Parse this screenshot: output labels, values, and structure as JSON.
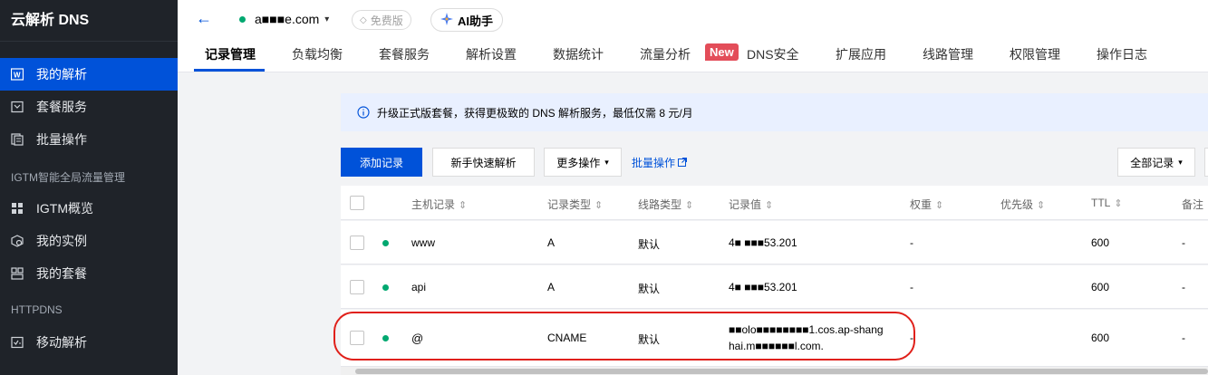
{
  "sidebar": {
    "title": "云解析 DNS",
    "items": [
      {
        "label": "我的解析",
        "icon": "w-icon"
      },
      {
        "label": "套餐服务",
        "icon": "package-icon"
      },
      {
        "label": "批量操作",
        "icon": "batch-icon"
      },
      {
        "label": "IGTM概览",
        "icon": "grid-icon"
      },
      {
        "label": "我的实例",
        "icon": "instance-icon"
      },
      {
        "label": "我的套餐",
        "icon": "list-icon"
      },
      {
        "label": "移动解析",
        "icon": "mobile-icon"
      }
    ],
    "groups": [
      "IGTM智能全局流量管理",
      "HTTPDNS"
    ]
  },
  "header": {
    "back": "←",
    "domain": "a■■■e.com",
    "free_badge": "免费版",
    "ai_label": "AI助手"
  },
  "tabs": [
    "记录管理",
    "负载均衡",
    "套餐服务",
    "解析设置",
    "数据统计",
    "流量分析",
    "DNS安全",
    "扩展应用",
    "线路管理",
    "权限管理",
    "操作日志"
  ],
  "new_badge": "New",
  "notice": "升级正式版套餐，获得更极致的 DNS 解析服务，最低仅需 8 元/月",
  "toolbar": {
    "add": "添加记录",
    "quick": "新手快速解析",
    "more": "更多操作",
    "batch": "批量操作",
    "filter": "全部记录"
  },
  "table": {
    "headers": [
      "主机记录",
      "记录类型",
      "线路类型",
      "记录值",
      "权重",
      "优先级",
      "TTL",
      "备注"
    ],
    "rows": [
      {
        "host": "www",
        "type": "A",
        "line": "默认",
        "value": "4■ ■■■53.201",
        "value2": "",
        "weight": "-",
        "priority": "",
        "ttl": "600",
        "note": "-"
      },
      {
        "host": "api",
        "type": "A",
        "line": "默认",
        "value": "4■ ■■■53.201",
        "value2": "",
        "weight": "-",
        "priority": "",
        "ttl": "600",
        "note": "-"
      },
      {
        "host": "@",
        "type": "CNAME",
        "line": "默认",
        "value": "■■olo■■■■■■■■1.cos.ap-shang",
        "value2": "hai.m■■■■■■l.com.",
        "weight": "-",
        "priority": "",
        "ttl": "600",
        "note": "-"
      }
    ]
  },
  "colors": {
    "accent": "#0052d9",
    "sidebar_bg": "#1f2329",
    "status_green": "#00a870",
    "new_badge": "#e34d59",
    "highlight": "#e0201a"
  }
}
